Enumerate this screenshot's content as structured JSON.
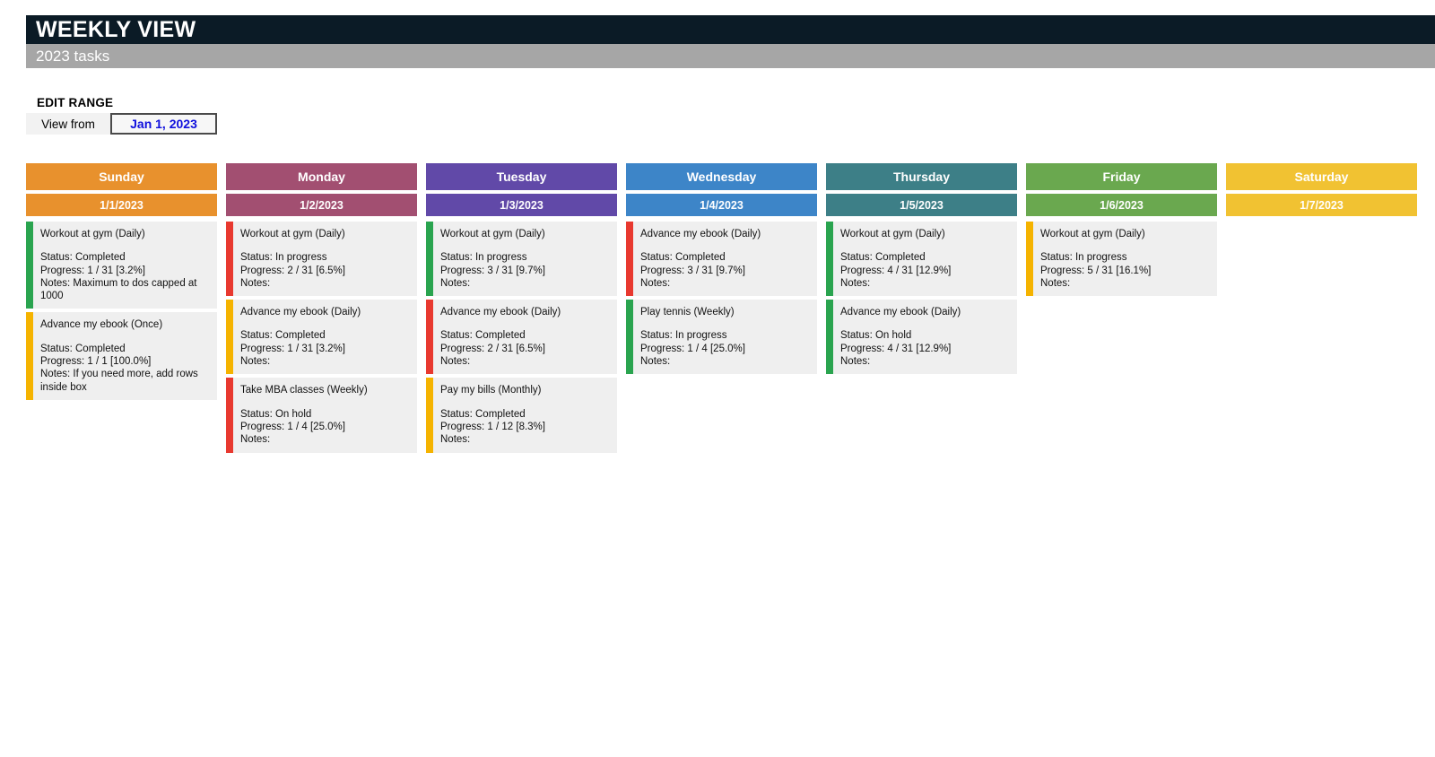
{
  "header": {
    "title": "WEEKLY VIEW",
    "subtitle": "2023 tasks"
  },
  "edit_range": {
    "label": "EDIT RANGE",
    "view_from_label": "View from",
    "view_from_value": "Jan 1, 2023"
  },
  "colors": {
    "title_bar": "#0b1b26",
    "subtitle_bar": "#a6a6a6",
    "sunday": "#e8912d",
    "monday": "#a24f71",
    "tuesday": "#6149a8",
    "wednesday": "#3d85c8",
    "thursday": "#3d7f87",
    "friday": "#6aa84f",
    "saturday": "#f1c232",
    "accent_green": "#27a košice"
  },
  "accent_palette": {
    "green": "#2aa council",
    "red": "#e8392f",
    "yellow": "#f5b300"
  },
  "days": [
    {
      "name": "Sunday",
      "date": "1/1/2023",
      "color": "#e8912d",
      "tasks": [
        {
          "title": "Workout at gym (Daily)",
          "status": "Status: Completed",
          "progress": "Progress: 1 / 31  [3.2%]",
          "notes": "Notes: Maximum to dos capped at 1000",
          "accent": "#2aa44f"
        },
        {
          "title": "Advance my ebook (Once)",
          "status": "Status: Completed",
          "progress": "Progress: 1 / 1  [100.0%]",
          "notes": "Notes: If you need more, add rows inside box",
          "accent": "#f5b300"
        }
      ]
    },
    {
      "name": "Monday",
      "date": "1/2/2023",
      "color": "#a24f71",
      "tasks": [
        {
          "title": "Workout at gym (Daily)",
          "status": "Status: In progress",
          "progress": "Progress: 2 / 31  [6.5%]",
          "notes": "Notes:",
          "accent": "#e8392f"
        },
        {
          "title": "Advance my ebook (Daily)",
          "status": "Status: Completed",
          "progress": "Progress: 1 / 31  [3.2%]",
          "notes": "Notes:",
          "accent": "#f5b300"
        },
        {
          "title": "Take MBA classes (Weekly)",
          "status": "Status: On hold",
          "progress": "Progress: 1 / 4  [25.0%]",
          "notes": "Notes:",
          "accent": "#e8392f"
        }
      ]
    },
    {
      "name": "Tuesday",
      "date": "1/3/2023",
      "color": "#6149a8",
      "tasks": [
        {
          "title": "Workout at gym (Daily)",
          "status": "Status: In progress",
          "progress": "Progress: 3 / 31  [9.7%]",
          "notes": "Notes:",
          "accent": "#2aa44f"
        },
        {
          "title": "Advance my ebook (Daily)",
          "status": "Status: Completed",
          "progress": "Progress: 2 / 31  [6.5%]",
          "notes": "Notes:",
          "accent": "#e8392f"
        },
        {
          "title": "Pay my bills (Monthly)",
          "status": "Status: Completed",
          "progress": "Progress: 1 / 12  [8.3%]",
          "notes": "Notes:",
          "accent": "#f5b300"
        }
      ]
    },
    {
      "name": "Wednesday",
      "date": "1/4/2023",
      "color": "#3d85c8",
      "tasks": [
        {
          "title": "Advance my ebook (Daily)",
          "status": "Status: Completed",
          "progress": "Progress: 3 / 31  [9.7%]",
          "notes": "Notes:",
          "accent": "#e8392f"
        },
        {
          "title": "Play tennis (Weekly)",
          "status": "Status: In progress",
          "progress": "Progress: 1 / 4  [25.0%]",
          "notes": "Notes:",
          "accent": "#2aa44f"
        }
      ]
    },
    {
      "name": "Thursday",
      "date": "1/5/2023",
      "color": "#3d7f87",
      "tasks": [
        {
          "title": "Workout at gym (Daily)",
          "status": "Status: Completed",
          "progress": "Progress: 4 / 31  [12.9%]",
          "notes": "Notes:",
          "accent": "#2aa44f"
        },
        {
          "title": "Advance my ebook (Daily)",
          "status": "Status: On hold",
          "progress": "Progress: 4 / 31  [12.9%]",
          "notes": "Notes:",
          "accent": "#2aa44f"
        }
      ]
    },
    {
      "name": "Friday",
      "date": "1/6/2023",
      "color": "#6aa84f",
      "tasks": [
        {
          "title": "Workout at gym (Daily)",
          "status": "Status: In progress",
          "progress": "Progress: 5 / 31  [16.1%]",
          "notes": "Notes:",
          "accent": "#f5b300"
        }
      ]
    },
    {
      "name": "Saturday",
      "date": "1/7/2023",
      "color": "#f1c232",
      "tasks": []
    }
  ]
}
